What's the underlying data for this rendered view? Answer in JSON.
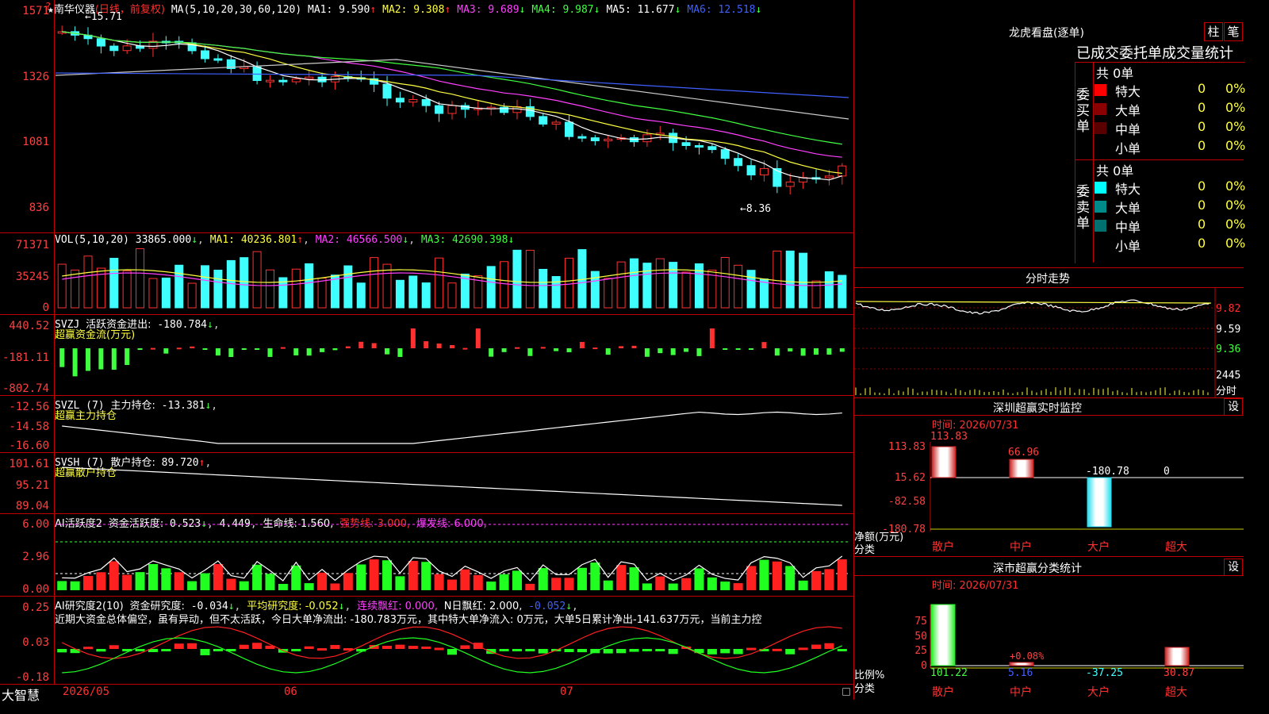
{
  "stock": {
    "name": "南华仪器",
    "period": "(日线，前复权)",
    "ma_label": "MA(5,10,20,30,60,120)",
    "ma": [
      {
        "label": "MA1:",
        "value": "9.590",
        "arrow": "↑",
        "color": "#ffffff"
      },
      {
        "label": "MA2:",
        "value": "9.308",
        "arrow": "↑",
        "color": "#ffff40"
      },
      {
        "label": "MA3:",
        "value": "9.689",
        "arrow": "↓",
        "color": "#ff40ff"
      },
      {
        "label": "MA4:",
        "value": "9.987",
        "arrow": "↓",
        "color": "#40ff40"
      },
      {
        "label": "MA5:",
        "value": "11.677",
        "arrow": "↓",
        "color": "#ffffff"
      },
      {
        "label": "MA6:",
        "value": "12.518",
        "arrow": "↓",
        "color": "#4060ff"
      }
    ],
    "y_ticks": [
      "1571",
      "1326",
      "1081",
      "836"
    ],
    "high_label": "15.71",
    "low_label": "8.36"
  },
  "volume": {
    "header": "VOL(5,10,20)",
    "value": "33865.000",
    "ma1": "40236.801",
    "ma2": "46566.500",
    "ma3": "42690.398",
    "y_ticks": [
      "71371",
      "35245",
      "0"
    ]
  },
  "svzj": {
    "name": "SVZJ",
    "label": "活跃资金进出:",
    "value": "-180.784",
    "subtitle": "超赢资金流(万元)",
    "y_ticks": [
      "440.52",
      "-181.11",
      "-802.74"
    ]
  },
  "svzl": {
    "name": "SVZL (7)",
    "label": "主力持仓:",
    "value": "-13.381",
    "subtitle": "超赢主力持仓",
    "y_ticks": [
      "-12.56",
      "-14.58",
      "-16.60"
    ]
  },
  "svsh": {
    "name": "SVSH (7)",
    "label": "散户持仓:",
    "value": "89.720",
    "subtitle": "超赢散户持仓",
    "y_ticks": [
      "101.61",
      "95.21",
      "89.04"
    ]
  },
  "ai_act": {
    "name": "AI活跃度2",
    "label": "资金活跃度:",
    "value1": "0.523",
    "value2": "4.449",
    "life": "生命线: 1.560,",
    "strong": "强势线: 3.000,",
    "burst": "爆发线: 6.000,",
    "y_ticks": [
      "6.00",
      "2.96",
      "0.00"
    ]
  },
  "ai_res": {
    "name": "AI研究度2(10)",
    "label": "资金研究度:",
    "value": "-0.034",
    "avg": "平均研究度: -0.052",
    "streak": "连续飘红: 0.000,",
    "nday": "N日飘红: 2.000,",
    "last": "-0.052",
    "comment": "近期大资金总体偏空，虽有异动，但不太活跃，今日大单净流出: -180.783万元，其中特大单净流入: 0万元，大单5日累计净出-141.637万元，当前主力控",
    "y_ticks": [
      "0.25",
      "0.03",
      "-0.18"
    ]
  },
  "footer": {
    "brand": "大智慧",
    "dates": [
      "2026/05",
      "06",
      "07"
    ]
  },
  "dragon": {
    "title": "龙虎看盘(逐单)",
    "btn_bar": "柱",
    "btn_pen": "笔",
    "subtitle": "已成交委托单成交量统计",
    "buy_label": "委买单",
    "sell_label": "委卖单",
    "buy_total": "共 0单",
    "sell_total": "共 0单",
    "buy_rows": [
      {
        "name": "特大",
        "count": "0",
        "pct": "0%",
        "color": "#ff0000"
      },
      {
        "name": "大单",
        "count": "0",
        "pct": "0%",
        "color": "#8b0000"
      },
      {
        "name": "中单",
        "count": "0",
        "pct": "0%",
        "color": "#5a0000"
      },
      {
        "name": "小单",
        "count": "0",
        "pct": "0%",
        "color": "#000000"
      }
    ],
    "sell_rows": [
      {
        "name": "特大",
        "count": "0",
        "pct": "0%",
        "color": "#00ffff"
      },
      {
        "name": "大单",
        "count": "0",
        "pct": "0%",
        "color": "#008b8b"
      },
      {
        "name": "中单",
        "count": "0",
        "pct": "0%",
        "color": "#007070"
      },
      {
        "name": "小单",
        "count": "0",
        "pct": "0%",
        "color": "#000000"
      }
    ]
  },
  "intraday": {
    "title": "分时走势",
    "y_ticks": [
      "9.82",
      "9.59",
      "9.36"
    ],
    "vol_label": "2445",
    "vol_sub": "分时"
  },
  "monitor": {
    "title": "深圳超赢实时监控",
    "settings": "设",
    "time": "时间: 2026/07/31",
    "y_ticks": [
      "113.83",
      "15.62",
      "-82.58",
      "-180.78"
    ],
    "y_unit": "净额(万元)",
    "x_unit": "分类",
    "categories": [
      "散户",
      "中户",
      "大户",
      "超大"
    ],
    "values": [
      113.83,
      66.96,
      -180.78,
      0
    ],
    "value_labels": [
      "113.83",
      "66.96",
      "-180.78",
      "0"
    ]
  },
  "stats": {
    "title": "深市超赢分类统计",
    "settings": "设",
    "time": "时间: 2026/07/31",
    "y_ticks": [
      "75",
      "50",
      "25",
      "0"
    ],
    "y_unit": "比例%",
    "x_unit": "分类",
    "categories": [
      "散户",
      "中户",
      "大户",
      "超大"
    ],
    "bottom_values": [
      "101.22",
      "5.16",
      "-37.25",
      "30.87"
    ],
    "mid_label": "+0.08%"
  }
}
